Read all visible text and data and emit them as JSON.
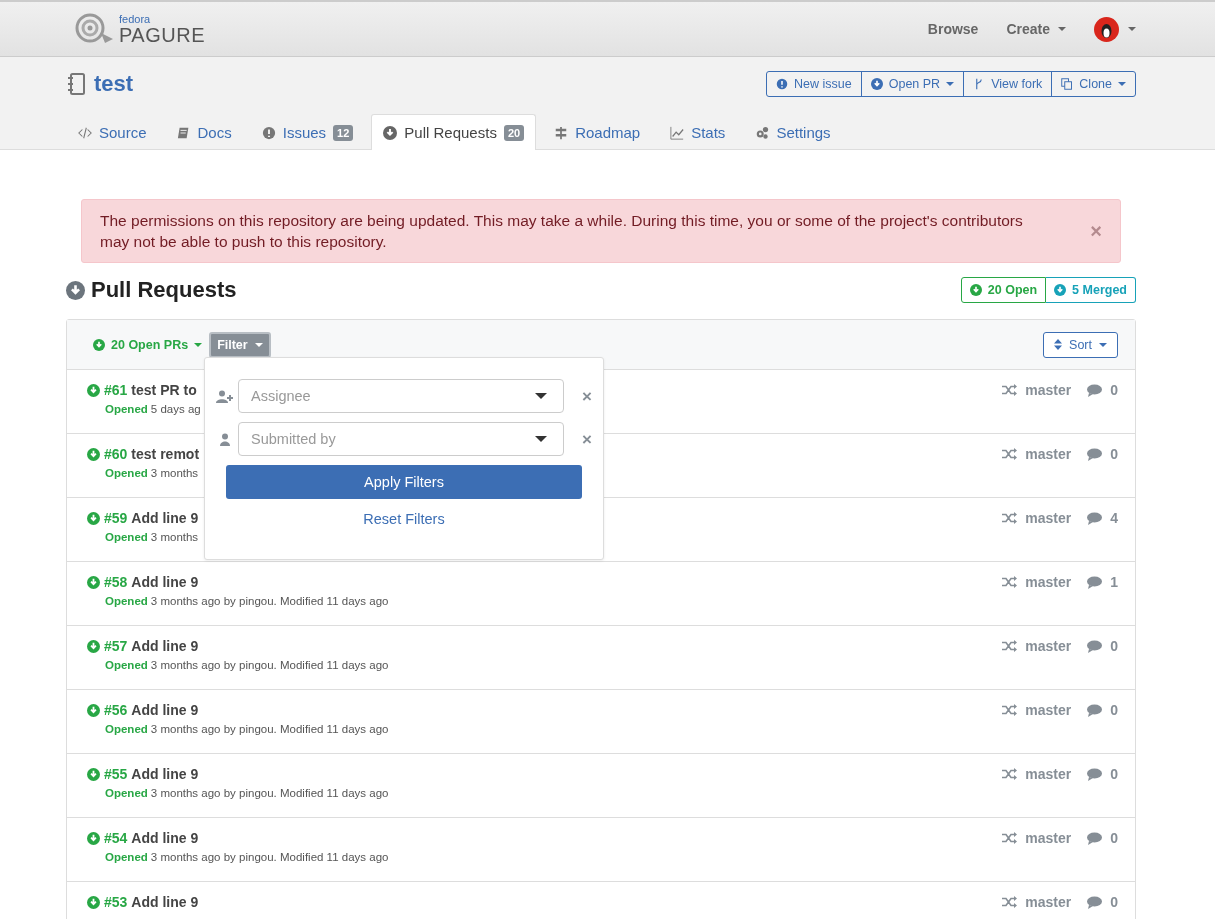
{
  "navbar": {
    "logo_top": "fedora",
    "logo_bottom": "PAGURE",
    "links": [
      {
        "label": "Browse",
        "kind": "link"
      },
      {
        "label": "Create",
        "kind": "dropdown"
      }
    ]
  },
  "repo": {
    "name": "test",
    "actions": [
      {
        "label": "New issue",
        "kind": "issue"
      },
      {
        "label": "Open PR",
        "kind": "pr"
      },
      {
        "label": "View fork",
        "kind": "fork"
      },
      {
        "label": "Clone",
        "kind": "clone"
      }
    ]
  },
  "tabs": [
    {
      "label": "Source",
      "kind": "code",
      "selected": false
    },
    {
      "label": "Docs",
      "kind": "book",
      "selected": false
    },
    {
      "label": "Issues",
      "kind": "issue",
      "count": "12",
      "selected": false
    },
    {
      "label": "Pull Requests",
      "kind": "pr",
      "count": "20",
      "selected": true
    },
    {
      "label": "Roadmap",
      "kind": "signpost",
      "selected": false
    },
    {
      "label": "Stats",
      "kind": "chart",
      "selected": false
    },
    {
      "label": "Settings",
      "kind": "gears",
      "selected": false
    }
  ],
  "alert": {
    "text": "The permissions on this repository are being updated. This may take a while. During this time, you or some of the project's contributors may not be able to push to this repository.",
    "close": "×"
  },
  "heading": "Pull Requests",
  "status_buttons": [
    {
      "label": "20 Open",
      "color": "#28a745"
    },
    {
      "label": "5 Merged",
      "color": "#17a2b8"
    }
  ],
  "toolbar": {
    "open_prs": "20 Open PRs",
    "filter": "Filter",
    "sort": "Sort"
  },
  "filter_popover": {
    "fields": [
      {
        "placeholder": "Assignee",
        "kind": "assignee",
        "clear": "×"
      },
      {
        "placeholder": "Submitted by",
        "kind": "user",
        "clear": "×"
      }
    ],
    "apply": "Apply Filters",
    "reset": "Reset Filters"
  },
  "rows": [
    {
      "id": "#61",
      "title": "test PR to",
      "status": "Opened",
      "meta": "5 days ag",
      "branch": "master",
      "comments": "0"
    },
    {
      "id": "#60",
      "title": "test remot",
      "status": "Opened",
      "meta": "3 months",
      "branch": "master",
      "comments": "0"
    },
    {
      "id": "#59",
      "title": "Add line 9",
      "status": "Opened",
      "meta": "3 months",
      "branch": "master",
      "comments": "4"
    },
    {
      "id": "#58",
      "title": "Add line 9",
      "status": "Opened",
      "meta": "3 months ago by pingou. Modified 11 days ago",
      "branch": "master",
      "comments": "1"
    },
    {
      "id": "#57",
      "title": "Add line 9",
      "status": "Opened",
      "meta": "3 months ago by pingou. Modified 11 days ago",
      "branch": "master",
      "comments": "0"
    },
    {
      "id": "#56",
      "title": "Add line 9",
      "status": "Opened",
      "meta": "3 months ago by pingou. Modified 11 days ago",
      "branch": "master",
      "comments": "0"
    },
    {
      "id": "#55",
      "title": "Add line 9",
      "status": "Opened",
      "meta": "3 months ago by pingou. Modified 11 days ago",
      "branch": "master",
      "comments": "0"
    },
    {
      "id": "#54",
      "title": "Add line 9",
      "status": "Opened",
      "meta": "3 months ago by pingou. Modified 11 days ago",
      "branch": "master",
      "comments": "0"
    },
    {
      "id": "#53",
      "title": "Add line 9",
      "branch": "master",
      "comments": "0"
    }
  ]
}
